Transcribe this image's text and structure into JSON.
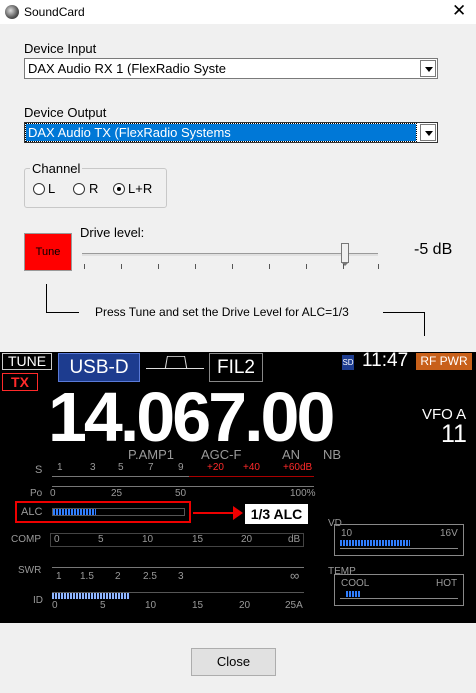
{
  "window": {
    "title": "SoundCard",
    "close_glyph": "✕"
  },
  "device_input": {
    "label": "Device Input",
    "value": "DAX Audio RX 1 (FlexRadio Syste"
  },
  "device_output": {
    "label": "Device Output",
    "value": "DAX Audio TX (FlexRadio Systems"
  },
  "channel": {
    "label": "Channel",
    "options": [
      {
        "label": "L",
        "selected": false
      },
      {
        "label": "R",
        "selected": false
      },
      {
        "label": "L+R",
        "selected": true
      }
    ]
  },
  "tune": {
    "label": "Tune",
    "color": "#ff0000"
  },
  "drive": {
    "label": "Drive level:",
    "value_text": "-5 dB",
    "slider_fraction": 0.9
  },
  "instruction": "Press Tune and set the Drive Level for ALC=1/3",
  "radio": {
    "tune_tag": "TUNE",
    "tx_tag": "TX",
    "mode": "USB-D",
    "filter": "FIL2",
    "sd_tag": "SD",
    "time": "11:47",
    "rf_pwr": "RF PWR",
    "frequency": "14.067.00",
    "vfo": "VFO A",
    "vfo_num": "11",
    "status": {
      "pamp": "P.AMP1",
      "agc": "AGC-F",
      "an": "AN",
      "nb": "NB"
    },
    "s_meter": {
      "label": "S",
      "ticks": [
        "1",
        "3",
        "5",
        "7",
        "9"
      ],
      "over_ticks": [
        "+20",
        "+40",
        "+60dB"
      ]
    },
    "po_meter": {
      "label": "Po",
      "ticks": [
        "0",
        "25",
        "50",
        "100%"
      ]
    },
    "alc_meter": {
      "label": "ALC",
      "level": 0.33
    },
    "alc_callout": "1/3 ALC",
    "comp_meter": {
      "label": "COMP",
      "ticks": [
        "0",
        "5",
        "10",
        "15",
        "20",
        "dB"
      ]
    },
    "swr_meter": {
      "label": "SWR",
      "ticks": [
        "1",
        "1.5",
        "2",
        "2.5",
        "3",
        "∞"
      ]
    },
    "id_meter": {
      "label": "ID",
      "ticks": [
        "0",
        "5",
        "10",
        "15",
        "20",
        "25A"
      ]
    },
    "vd_meter": {
      "label": "VD",
      "low": "10",
      "high": "16V"
    },
    "temp_meter": {
      "label": "TEMP",
      "low": "COOL",
      "high": "HOT"
    }
  },
  "close_button": {
    "label": "Close"
  }
}
